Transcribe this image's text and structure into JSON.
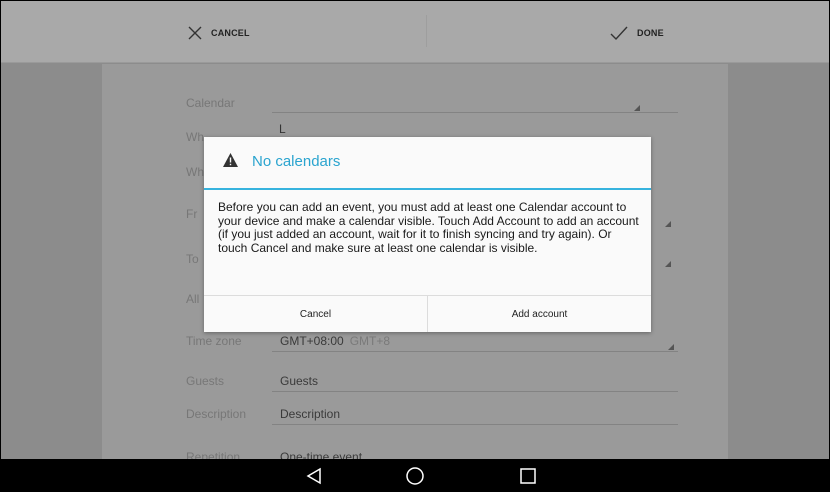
{
  "action_bar": {
    "cancel_label": "CANCEL",
    "cancel_icon": "close-icon",
    "done_label": "DONE",
    "done_icon": "check-icon"
  },
  "form": {
    "rows": [
      {
        "label": "Calendar",
        "value": ""
      },
      {
        "label": "Wh",
        "value": ""
      },
      {
        "label": "Wh",
        "value": ""
      },
      {
        "label": "Fr",
        "value": ""
      },
      {
        "label": "To",
        "value": ""
      },
      {
        "label": "All",
        "value": ""
      },
      {
        "label": "Time zone",
        "value": "GMT+08:00",
        "sub": "GMT+8"
      },
      {
        "label": "Guests",
        "value": "Guests"
      },
      {
        "label": "Description",
        "value": "Description"
      },
      {
        "label": "Repetition",
        "value": "One-time event"
      }
    ]
  },
  "dialog": {
    "icon": "warning-icon",
    "title": "No calendars",
    "message": "Before you can add an event, you must add at least one Calendar account to your device and make a calendar visible. Touch Add Account to add an account (if you just added an account, wait for it to finish syncing and try again). Or touch Cancel and make sure at least one calendar is visible.",
    "cancel_label": "Cancel",
    "add_account_label": "Add account",
    "accent_color": "#36b3de"
  },
  "nav": {
    "back_icon": "back-icon",
    "home_icon": "home-icon",
    "recents_icon": "recents-icon"
  }
}
